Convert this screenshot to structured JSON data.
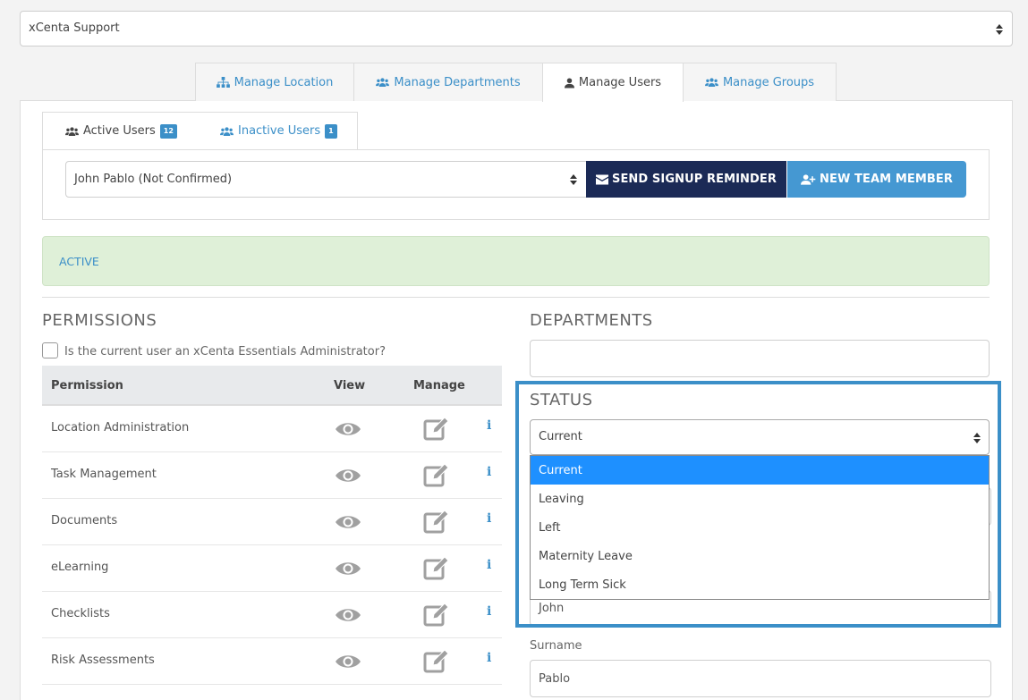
{
  "company_select": {
    "value": "xCenta Support"
  },
  "main_tabs": [
    {
      "label": "Manage Location",
      "icon": "sitemap-icon"
    },
    {
      "label": "Manage Departments",
      "icon": "users-icon"
    },
    {
      "label": "Manage Users",
      "icon": "user-icon",
      "active": true
    },
    {
      "label": "Manage Groups",
      "icon": "users-icon"
    }
  ],
  "user_tabs": {
    "active": {
      "label": "Active Users",
      "count": "12"
    },
    "inactive": {
      "label": "Inactive Users",
      "count": "1"
    }
  },
  "user_select": {
    "value": "John Pablo (Not Confirmed)"
  },
  "buttons": {
    "signup_reminder": "SEND SIGNUP REMINDER",
    "new_member": "NEW TEAM MEMBER"
  },
  "status_alert": {
    "text": "ACTIVE"
  },
  "permissions": {
    "title": "PERMISSIONS",
    "admin_question": "Is the current user an xCenta Essentials Administrator?",
    "columns": {
      "permission": "Permission",
      "view": "View",
      "manage": "Manage"
    },
    "rows": [
      "Location Administration",
      "Task Management",
      "Documents",
      "eLearning",
      "Checklists",
      "Risk Assessments"
    ]
  },
  "departments": {
    "title": "DEPARTMENTS"
  },
  "status": {
    "title": "STATUS",
    "value": "Current",
    "options": [
      "Current",
      "Leaving",
      "Left",
      "Maternity Leave",
      "Long Term Sick"
    ]
  },
  "first_name": {
    "value": "John"
  },
  "surname": {
    "label": "Surname",
    "value": "Pablo"
  },
  "colors": {
    "accent": "#3b8fc8",
    "dark_button": "#1b2a56",
    "blue_button": "#4598d2",
    "alert_bg": "#dff0d8",
    "selected_option": "#1e90ff"
  }
}
